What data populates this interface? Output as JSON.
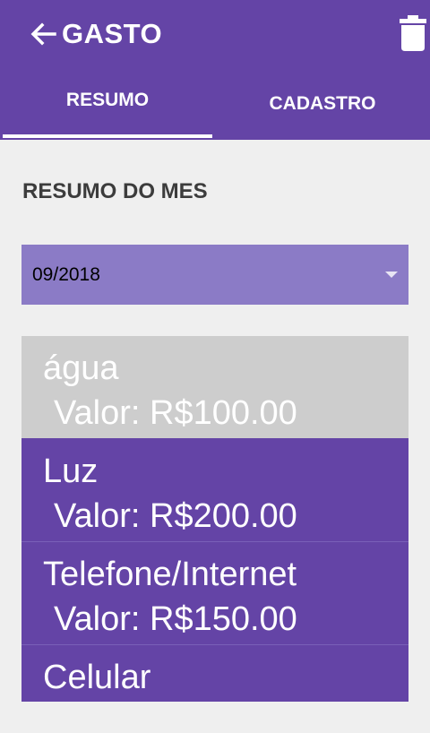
{
  "appbar": {
    "title": "GASTO",
    "back_icon": "arrow-left-icon",
    "delete_icon": "trash-icon"
  },
  "tabs": [
    {
      "label": "RESUMO",
      "active": true
    },
    {
      "label": "CADASTRO",
      "active": false
    }
  ],
  "summary": {
    "section_title": "RESUMO DO MES",
    "selected_month": "09/2018",
    "expenses": [
      {
        "name": "água",
        "value_text": " Valor: R$100.00",
        "selected": true
      },
      {
        "name": "Luz",
        "value_text": " Valor: R$200.00",
        "selected": false
      },
      {
        "name": "Telefone/Internet",
        "value_text": " Valor: R$150.00",
        "selected": false
      },
      {
        "name": "Celular",
        "value_text": "",
        "selected": false
      }
    ]
  },
  "colors": {
    "primary": "#6444a6",
    "dropdown_bg": "#8b7bc6",
    "selected_item_bg": "#cdcdcd",
    "page_bg": "#efefef"
  }
}
